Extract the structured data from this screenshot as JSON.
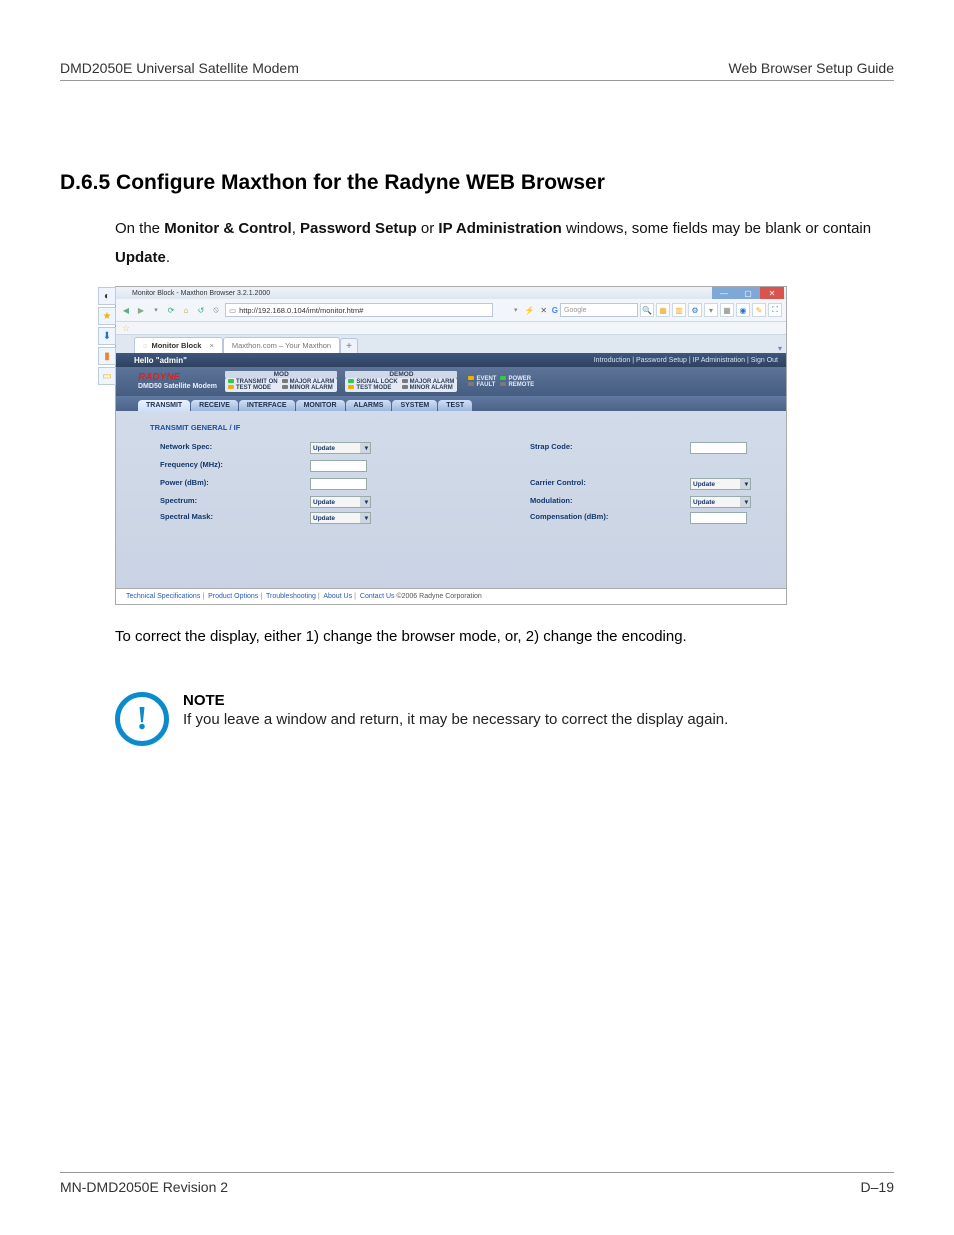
{
  "header": {
    "left": "DMD2050E Universal Satellite Modem",
    "right": "Web Browser Setup Guide"
  },
  "section": {
    "number": "D.6.5",
    "title": "Configure Maxthon for the Radyne WEB Browser",
    "intro_1a": "On the ",
    "intro_b1": "Monitor & Control",
    "intro_1b": ", ",
    "intro_b2": "Password Setup",
    "intro_1c": " or ",
    "intro_b3": "IP Administration",
    "intro_1d": " windows, some fields may be blank or contain ",
    "intro_b4": "Update",
    "intro_1e": "."
  },
  "browser": {
    "title": "Monitor Block - Maxthon Browser 3.2.1.2000",
    "url": "http://192.168.0.104/imt/monitor.htm#",
    "search_placeholder": "Google",
    "tabs": {
      "active": "Monitor Block",
      "secondary": "Maxthon.com – Your Maxthon"
    },
    "greeting": "Hello \"admin\"",
    "toplinks": "Introduction  |  Password Setup  |  IP Administration  |  Sign Out",
    "logo": "RADYNE",
    "model": "DMD50 Satellite Modem",
    "status": {
      "mod": {
        "head": "MOD",
        "r1a": "TRANSMIT ON",
        "r1b": "MAJOR ALARM",
        "r2a": "TEST MODE",
        "r2b": "MINOR ALARM"
      },
      "demod": {
        "head": "DEMOD",
        "r1a": "SIGNAL LOCK",
        "r1b": "MAJOR ALARM",
        "r2a": "TEST MODE",
        "r2b": "MINOR ALARM"
      },
      "misc": {
        "r1a": "EVENT",
        "r1b": "POWER",
        "r2a": "FAULT",
        "r2b": "REMOTE"
      }
    },
    "navtabs": [
      "TRANSMIT",
      "RECEIVE",
      "INTERFACE",
      "MONITOR",
      "ALARMS",
      "SYSTEM",
      "TEST"
    ],
    "breadcrumb": "TRANSMIT GENERAL / IF",
    "form": {
      "left_labels": [
        "Network Spec:",
        "Frequency (MHz):",
        "Power (dBm):",
        "Spectrum:",
        "Spectral Mask:"
      ],
      "right_labels": [
        "Strap Code:",
        "Carrier Control:",
        "Modulation:",
        "Compensation (dBm):"
      ],
      "select_text": "Update"
    },
    "footer": {
      "links": [
        "Technical Specifications",
        "Product Options",
        "Troubleshooting",
        "About Us",
        "Contact Us"
      ],
      "copyright": "©2006 Radyne Corporation"
    }
  },
  "after": "To correct the display, either 1) change the browser mode, or, 2) change the encoding.",
  "note": {
    "title": "NOTE",
    "body": "If you leave a window and return, it may be necessary to correct the display again."
  },
  "footer": {
    "left": "MN-DMD2050E    Revision 2",
    "right": "D–19"
  }
}
